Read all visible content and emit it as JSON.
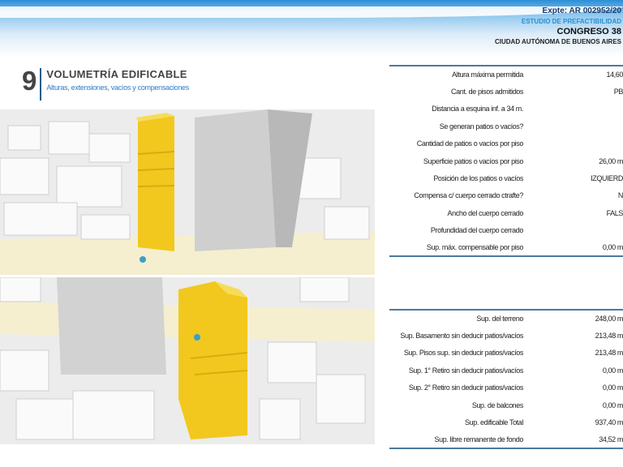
{
  "header": {
    "expediente": "Expte: AR 002952/20",
    "estudio": "ESTUDIO DE PREFACTIBILIDAD",
    "direccion": "CONGRESO 38",
    "ciudad": "CIUDAD AUTÓNOMA DE BUENOS AIRES"
  },
  "section": {
    "number": "9",
    "title": "VOLUMETRÍA EDIFICABLE",
    "subtitle": "Alturas, extensiones, vacíos y compensaciones"
  },
  "colors": {
    "accent": "#2a8fd6",
    "building": "#f2c81e",
    "table_border": "#4a7aa0"
  },
  "table1": [
    {
      "label": "Altura máxima permitida",
      "value": "14,60"
    },
    {
      "label": "Cant. de pisos admitidos",
      "value": "PB"
    },
    {
      "label": "Distancia a esquina inf. a 34 m.",
      "value": ""
    },
    {
      "label": "Se generan patios o vacíos?",
      "value": ""
    },
    {
      "label": "Cantidad de patios o vacíos por piso",
      "value": ""
    },
    {
      "label": "Superficie patios o vacíos por piso",
      "value": "26,00 m"
    },
    {
      "label": "Posición de los patios o vacíos",
      "value": "IZQUIERD"
    },
    {
      "label": "Compensa c/ cuerpo cerrado ctrafte?",
      "value": "N"
    },
    {
      "label": "Ancho del  cuerpo cerrado",
      "value": "FALS"
    },
    {
      "label": "Profundidad del  cuerpo cerrado",
      "value": ""
    },
    {
      "label": "Sup. máx. compensable por piso",
      "value": "0,00 m"
    }
  ],
  "table2": [
    {
      "label": "Sup. del terreno",
      "value": "248,00 m"
    },
    {
      "label": "Sup. Basamento sin deducir patios/vacíos",
      "value": "213,48 m"
    },
    {
      "label": "Sup. Pisos sup. sin deducir patios/vacíos",
      "value": "213,48 m"
    },
    {
      "label": "Sup. 1° Retiro sin deducir patios/vacíos",
      "value": "0,00 m"
    },
    {
      "label": "Sup. 2° Retiro sin deducir patios/vacíos",
      "value": "0,00 m"
    },
    {
      "label": "Sup. de balcones",
      "value": "0,00 m"
    },
    {
      "label": "Sup. edificable Total",
      "value": "937,40 m"
    },
    {
      "label": "Sup. libre remanente de fondo",
      "value": "34,52 m"
    }
  ]
}
